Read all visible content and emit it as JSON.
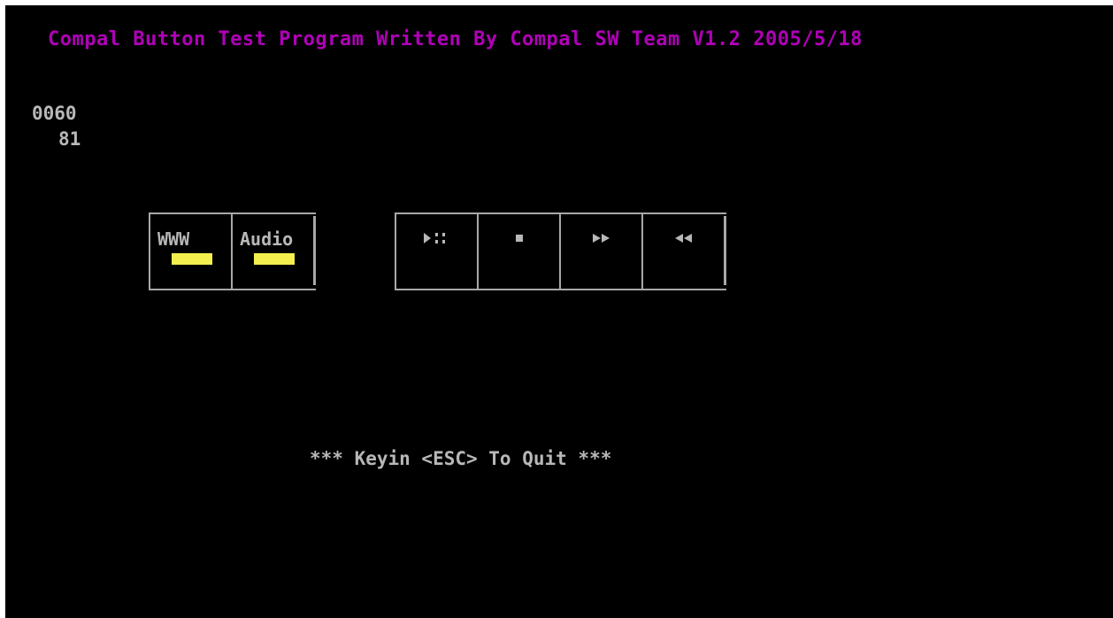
{
  "header": {
    "title": "Compal Button Test Program Written By Compal SW Team V1.2 2005/5/18"
  },
  "status": {
    "code_line1": "0060",
    "code_line2": "81"
  },
  "buttons_left": [
    {
      "label": "WWW",
      "indicator": "#f2ef4e"
    },
    {
      "label": "Audio",
      "indicator": "#f2ef4e"
    }
  ],
  "buttons_media": [
    {
      "icon": "play-pause-icon"
    },
    {
      "icon": "stop-icon"
    },
    {
      "icon": "fast-forward-icon"
    },
    {
      "icon": "rewind-icon"
    }
  ],
  "footer": {
    "hint": "*** Keyin <ESC> To Quit ***"
  },
  "colors": {
    "background": "#000000",
    "title": "#b000b8",
    "text": "#b8b8b8",
    "frame": "#a8a8a8",
    "indicator": "#f2ef4e"
  }
}
